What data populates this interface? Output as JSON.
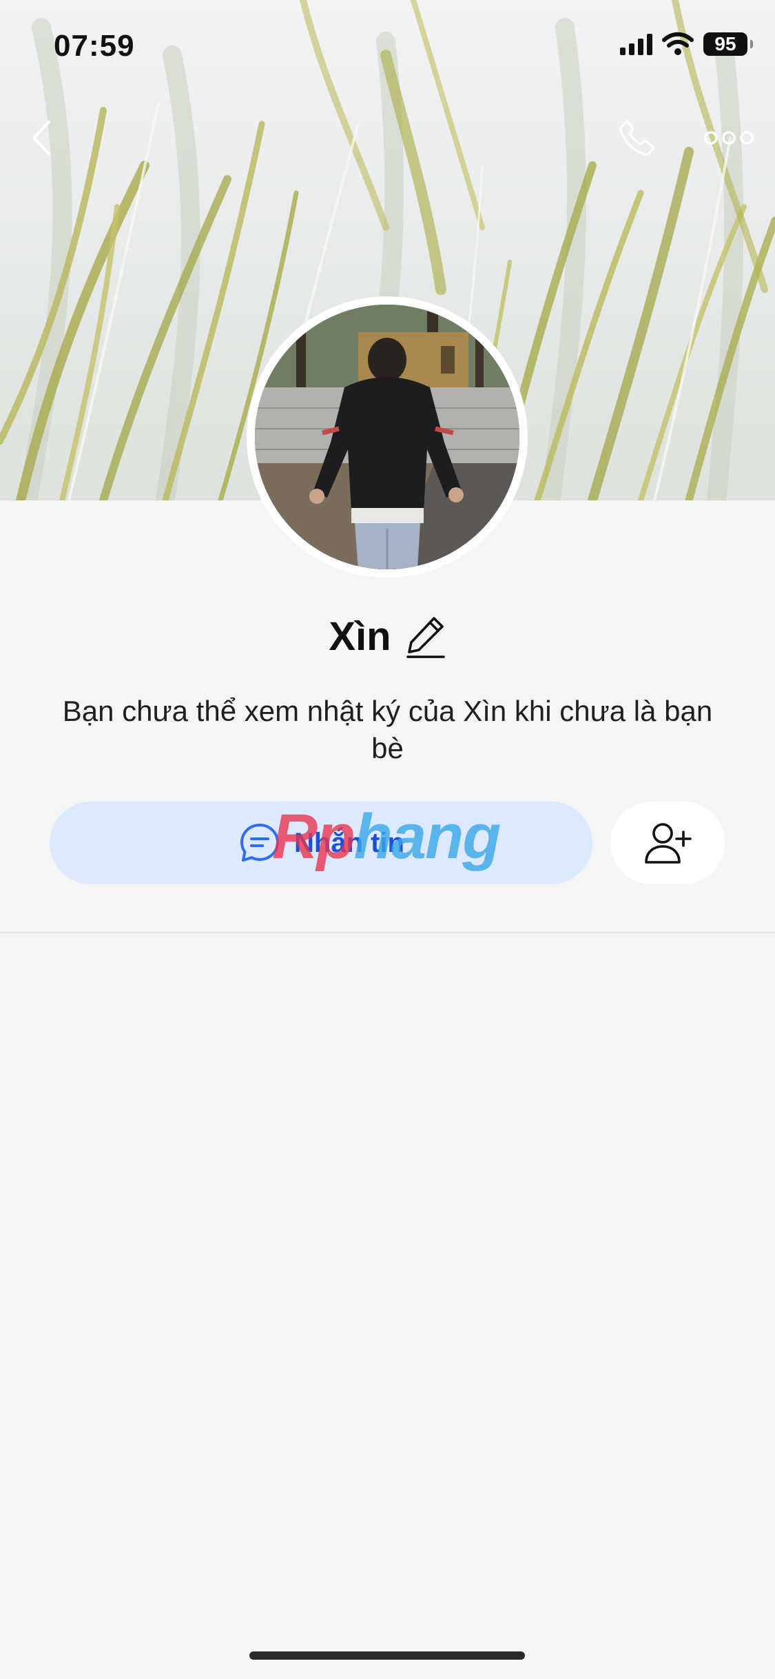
{
  "status_bar": {
    "time": "07:59",
    "battery": "95",
    "icons": [
      "cellular-signal-icon",
      "wifi-icon",
      "battery-icon"
    ]
  },
  "nav": {
    "back_icon": "chevron-left-icon",
    "call_icon": "phone-icon",
    "more_icon": "more-horizontal-icon"
  },
  "profile": {
    "name": "Xìn",
    "edit_icon": "pencil-icon",
    "restriction_text": "Bạn chưa thể xem nhật ký của Xìn khi chưa là bạn bè"
  },
  "actions": {
    "message_label": "Nhắn tin",
    "message_icon": "chat-bubble-icon",
    "add_friend_icon": "add-user-icon"
  },
  "watermark": {
    "part1": "Rp",
    "part2": "hang"
  },
  "colors": {
    "background": "#f4f5f4",
    "message_button_bg": "#dce9ff",
    "message_button_text": "#1a4fd6",
    "accent_blue": "#2f6df6"
  }
}
